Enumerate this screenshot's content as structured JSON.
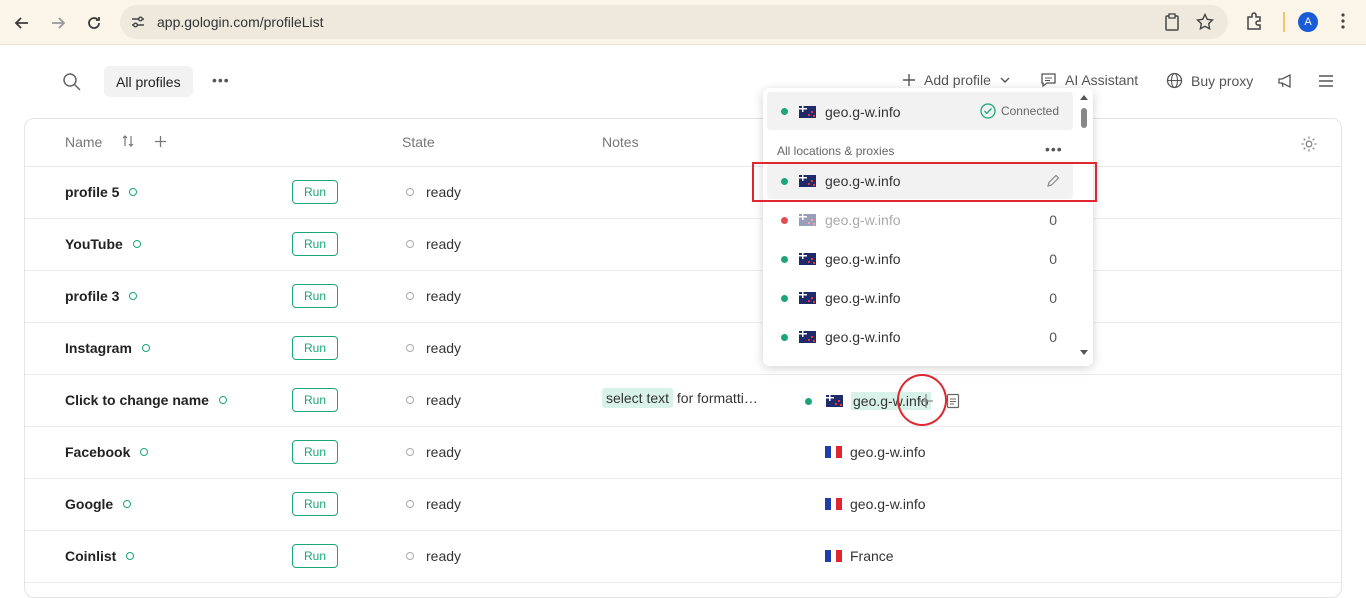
{
  "browser": {
    "url": "app.gologin.com/profileList",
    "avatar_letter": "A"
  },
  "toolbar": {
    "all_profiles": "All profiles",
    "more": "•••",
    "add_profile": "Add profile",
    "ai_assistant": "AI Assistant",
    "buy_proxy": "Buy proxy"
  },
  "table": {
    "headers": {
      "name": "Name",
      "state": "State",
      "notes": "Notes"
    },
    "run_label": "Run",
    "rows": [
      {
        "name": "profile 5",
        "state": "ready",
        "proxy": "",
        "flag": ""
      },
      {
        "name": "YouTube",
        "state": "ready",
        "proxy": "",
        "flag": ""
      },
      {
        "name": "profile 3",
        "state": "ready",
        "proxy": "",
        "flag": ""
      },
      {
        "name": "Instagram",
        "state": "ready",
        "proxy": "",
        "flag": ""
      },
      {
        "name": "Click to change name",
        "state": "ready",
        "notes_chip": "select text",
        "notes_rest": "for formatti…",
        "proxy": "geo.g-w.info",
        "flag": "nz"
      },
      {
        "name": "Facebook",
        "state": "ready",
        "proxy": "geo.g-w.info",
        "flag": "fr"
      },
      {
        "name": "Google",
        "state": "ready",
        "proxy": "geo.g-w.info",
        "flag": "fr"
      },
      {
        "name": "Coinlist",
        "state": "ready",
        "proxy": "France",
        "flag": "fr"
      }
    ]
  },
  "dropdown": {
    "current": {
      "label": "geo.g-w.info",
      "status": "Connected"
    },
    "section_title": "All locations & proxies",
    "section_more": "•••",
    "items": [
      {
        "label": "geo.g-w.info",
        "count": "",
        "status_color": "#1aa57a",
        "dim": false
      },
      {
        "label": "geo.g-w.info",
        "count": "0",
        "status_color": "#e05050",
        "dim": true
      },
      {
        "label": "geo.g-w.info",
        "count": "0",
        "status_color": "#1aa57a",
        "dim": false
      },
      {
        "label": "geo.g-w.info",
        "count": "0",
        "status_color": "#1aa57a",
        "dim": false
      },
      {
        "label": "geo.g-w.info",
        "count": "0",
        "status_color": "#1aa57a",
        "dim": false
      }
    ]
  },
  "colors": {
    "accent": "#1aa57a",
    "annotation": "#e0262e"
  }
}
